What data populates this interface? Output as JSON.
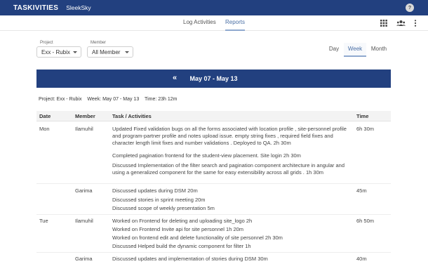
{
  "app": {
    "brand": "TASKIVITIES",
    "org": "SleekSky",
    "avatar": "?"
  },
  "nav": {
    "tab_log": "Log Activities",
    "tab_reports": "Reports",
    "icons": [
      "grid-icon",
      "people-icon",
      "more-vertical-icon"
    ]
  },
  "filters": {
    "project_label": "Project",
    "project_value": "Exx - Rubix",
    "member_label": "Member",
    "member_value": "All Member"
  },
  "period": {
    "day": "Day",
    "week": "Week",
    "month": "Month",
    "active": "Week"
  },
  "report": {
    "range": "May 07 - May 13",
    "prev_symbol": "«",
    "summary_project": "Project: Exx - Rubix",
    "summary_week": "Week: May 07 - May 13",
    "summary_time": "Time: 23h 12m"
  },
  "table": {
    "headers": {
      "date": "Date",
      "member": "Member",
      "task": "Task / Activities",
      "time": "Time"
    },
    "rows": [
      {
        "date": "Mon",
        "member": "Ilamuhil",
        "time": "6h 30m",
        "activities": [
          "Updated Fixed validation bugs on all the forms associated with location profile , site-personnel profile and program-partner profile and notes upload issue. empty string fixes , required field fixes and character length limit fixes and number validations . Deployed to QA. 2h 30m",
          "Completed pagination frontend for the student-view placement. Site login 2h 30m",
          "Discussed Implementation of the filter search and pagination component architecture in angular and using a generalized component for the same for easy extensibility across all grids . 1h 30m"
        ]
      },
      {
        "date": "",
        "member": "Garima",
        "time": "45m",
        "activities": [
          "Discussed updates during DSM 20m",
          "Discussed stories in sprint meeting 20m",
          "Discussed scope of weekly presentation 5m"
        ]
      },
      {
        "date": "Tue",
        "member": "Ilamuhil",
        "time": "6h 50m",
        "activities": [
          "Worked on Frontend for deleting and uploading site_logo 2h",
          "Worked on Frontend Invite api for site personnel 1h 20m",
          "Worked on frontend edit and delete functionality of site personnel 2h 30m",
          "Discussed Helped build the dynamic component for filter 1h"
        ]
      },
      {
        "date": "",
        "member": "Garima",
        "time": "40m",
        "activities": [
          "Discussed updates and implementation of stories during DSM 30m"
        ]
      }
    ]
  }
}
